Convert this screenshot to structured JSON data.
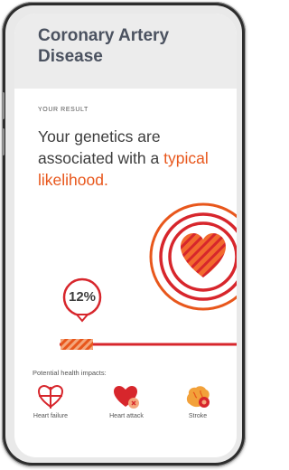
{
  "condition": {
    "title": "Coronary Artery Disease"
  },
  "result": {
    "section_label": "YOUR RESULT",
    "headline_prefix": "Your genetics are associated with a",
    "headline_highlight": "typical likelihood.",
    "percentage": "12%"
  },
  "impacts": {
    "label": "Potential health impacts:",
    "items": [
      {
        "label": "Heart failure",
        "icon": "heart-failure-icon"
      },
      {
        "label": "Heart attack",
        "icon": "heart-attack-icon"
      },
      {
        "label": "Stroke",
        "icon": "stroke-icon"
      }
    ]
  },
  "colors": {
    "accent": "#e8571c",
    "red": "#d7262c",
    "header_bg": "#ececec",
    "text": "#3d3d3d"
  }
}
